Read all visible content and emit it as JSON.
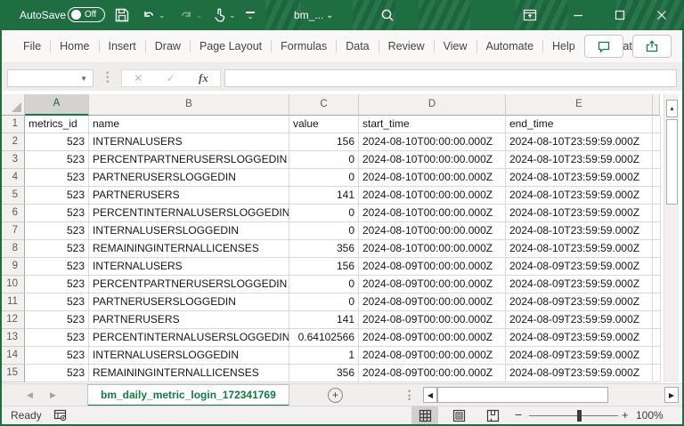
{
  "colors": {
    "titlebar": "#1E6E42",
    "accent": "#107C41"
  },
  "titlebar": {
    "autosave_label": "AutoSave",
    "autosave_state": "Off",
    "file_name": "bm_..."
  },
  "menu": {
    "items": [
      "File",
      "Home",
      "Insert",
      "Draw",
      "Page Layout",
      "Formulas",
      "Data",
      "Review",
      "View",
      "Automate",
      "Help",
      "Acrobat"
    ]
  },
  "formula_bar": {
    "name_box_value": "",
    "fx_label": "fx",
    "formula_value": ""
  },
  "grid": {
    "column_letters": [
      "A",
      "B",
      "C",
      "D",
      "E"
    ],
    "active_column": "A",
    "header_row": [
      "metrics_id",
      "name",
      "value",
      "start_time",
      "end_time"
    ],
    "rows": [
      [
        "523",
        "INTERNALUSERS",
        "156",
        "2024-08-10T00:00:00.000Z",
        "2024-08-10T23:59:59.000Z"
      ],
      [
        "523",
        "PERCENTPARTNERUSERSLOGGEDIN",
        "0",
        "2024-08-10T00:00:00.000Z",
        "2024-08-10T23:59:59.000Z"
      ],
      [
        "523",
        "PARTNERUSERSLOGGEDIN",
        "0",
        "2024-08-10T00:00:00.000Z",
        "2024-08-10T23:59:59.000Z"
      ],
      [
        "523",
        "PARTNERUSERS",
        "141",
        "2024-08-10T00:00:00.000Z",
        "2024-08-10T23:59:59.000Z"
      ],
      [
        "523",
        "PERCENTINTERNALUSERSLOGGEDIN",
        "0",
        "2024-08-10T00:00:00.000Z",
        "2024-08-10T23:59:59.000Z"
      ],
      [
        "523",
        "INTERNALUSERSLOGGEDIN",
        "0",
        "2024-08-10T00:00:00.000Z",
        "2024-08-10T23:59:59.000Z"
      ],
      [
        "523",
        "REMAININGINTERNALLICENSES",
        "356",
        "2024-08-10T00:00:00.000Z",
        "2024-08-10T23:59:59.000Z"
      ],
      [
        "523",
        "INTERNALUSERS",
        "156",
        "2024-08-09T00:00:00.000Z",
        "2024-08-09T23:59:59.000Z"
      ],
      [
        "523",
        "PERCENTPARTNERUSERSLOGGEDIN",
        "0",
        "2024-08-09T00:00:00.000Z",
        "2024-08-09T23:59:59.000Z"
      ],
      [
        "523",
        "PARTNERUSERSLOGGEDIN",
        "0",
        "2024-08-09T00:00:00.000Z",
        "2024-08-09T23:59:59.000Z"
      ],
      [
        "523",
        "PARTNERUSERS",
        "141",
        "2024-08-09T00:00:00.000Z",
        "2024-08-09T23:59:59.000Z"
      ],
      [
        "523",
        "PERCENTINTERNALUSERSLOGGEDIN",
        "0.64102566",
        "2024-08-09T00:00:00.000Z",
        "2024-08-09T23:59:59.000Z"
      ],
      [
        "523",
        "INTERNALUSERSLOGGEDIN",
        "1",
        "2024-08-09T00:00:00.000Z",
        "2024-08-09T23:59:59.000Z"
      ],
      [
        "523",
        "REMAININGINTERNALLICENSES",
        "356",
        "2024-08-09T00:00:00.000Z",
        "2024-08-09T23:59:59.000Z"
      ]
    ]
  },
  "sheet_tabs": {
    "active_tab": "bm_daily_metric_login_172341769",
    "add_sheet_label": "+"
  },
  "status_bar": {
    "mode": "Ready",
    "zoom_level": "100%",
    "zoom_out_label": "−",
    "zoom_in_label": "+"
  }
}
